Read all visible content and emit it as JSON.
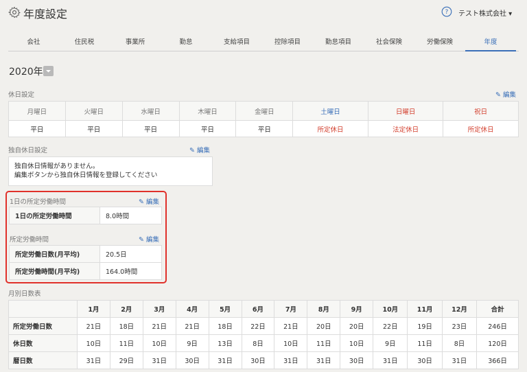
{
  "header": {
    "title": "年度設定",
    "company": "テスト株式会社 ▾",
    "gear_icon": "gear-icon",
    "help_icon": "help-icon"
  },
  "tabs": [
    "会社",
    "住民税",
    "事業所",
    "勤怠",
    "支給項目",
    "控除項目",
    "勤怠項目",
    "社会保険",
    "労働保険",
    "年度"
  ],
  "active_tab": "年度",
  "year": {
    "label": "2020年"
  },
  "holiday_section": {
    "label": "休日設定",
    "edit": "編集",
    "headers": [
      "月曜日",
      "火曜日",
      "水曜日",
      "木曜日",
      "金曜日",
      "土曜日",
      "日曜日",
      "祝日"
    ],
    "values": [
      "平日",
      "平日",
      "平日",
      "平日",
      "平日",
      "所定休日",
      "法定休日",
      "所定休日"
    ]
  },
  "custom_holiday": {
    "label": "独自休日設定",
    "edit": "編集",
    "line1": "独自休日情報がありません。",
    "line2": "編集ボタンから独自休日情報を登録してください"
  },
  "daily_hours": {
    "label": "1日の所定労働時間",
    "edit": "編集",
    "rows": [
      {
        "key": "1日の所定労働時間",
        "value": "8.0時間"
      }
    ]
  },
  "work_time": {
    "label": "所定労働時間",
    "edit": "編集",
    "rows": [
      {
        "key": "所定労働日数(月平均)",
        "value": "20.5日"
      },
      {
        "key": "所定労働時間(月平均)",
        "value": "164.0時間"
      }
    ]
  },
  "monthly": {
    "label": "月別日数表",
    "headers": [
      "",
      "1月",
      "2月",
      "3月",
      "4月",
      "5月",
      "6月",
      "7月",
      "8月",
      "9月",
      "10月",
      "11月",
      "12月",
      "合計"
    ],
    "rows": [
      {
        "name": "所定労働日数",
        "values": [
          "21日",
          "18日",
          "21日",
          "21日",
          "18日",
          "22日",
          "21日",
          "20日",
          "20日",
          "22日",
          "19日",
          "23日",
          "246日"
        ]
      },
      {
        "name": "休日数",
        "values": [
          "10日",
          "11日",
          "10日",
          "9日",
          "13日",
          "8日",
          "10日",
          "11日",
          "10日",
          "9日",
          "11日",
          "8日",
          "120日"
        ]
      },
      {
        "name": "暦日数",
        "values": [
          "31日",
          "29日",
          "31日",
          "30日",
          "31日",
          "30日",
          "31日",
          "31日",
          "30日",
          "31日",
          "30日",
          "31日",
          "366日"
        ]
      }
    ]
  },
  "colors": {
    "accent": "#3a6fb8",
    "red": "#d3402f",
    "highlight": "#e0302a"
  }
}
